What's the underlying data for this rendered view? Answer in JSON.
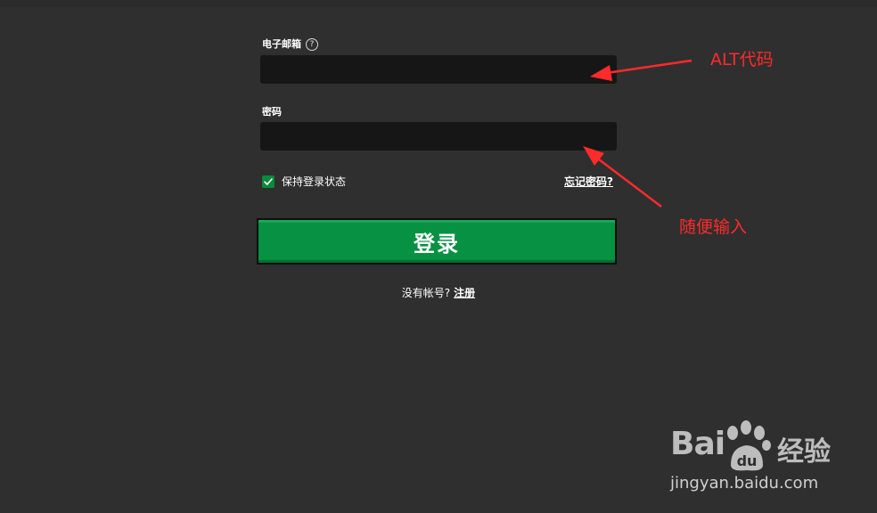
{
  "form": {
    "email_label": "电子邮箱",
    "help_glyph": "?",
    "email_value": "",
    "password_label": "密码",
    "password_value": "",
    "remember_label": "保持登录状态",
    "remember_checked": true,
    "forgot_label": "忘记密码?",
    "login_label": "登录",
    "no_account_text": "没有帐号?",
    "register_label": "注册"
  },
  "annotations": {
    "email_note": "ALT代码",
    "password_note": "随便输入"
  },
  "watermark": {
    "brand": "Bai",
    "brand_suffix": "经验",
    "url": "jingyan.baidu.com"
  },
  "colors": {
    "background": "#2f2f2f",
    "input_bg": "#161616",
    "accent_green": "#079143",
    "annotation_red": "#ff2a2a"
  },
  "icons": {
    "help": "help-circle-icon",
    "checkbox": "checkmark-icon",
    "arrow": "arrow-icon",
    "paw": "paw-icon"
  }
}
